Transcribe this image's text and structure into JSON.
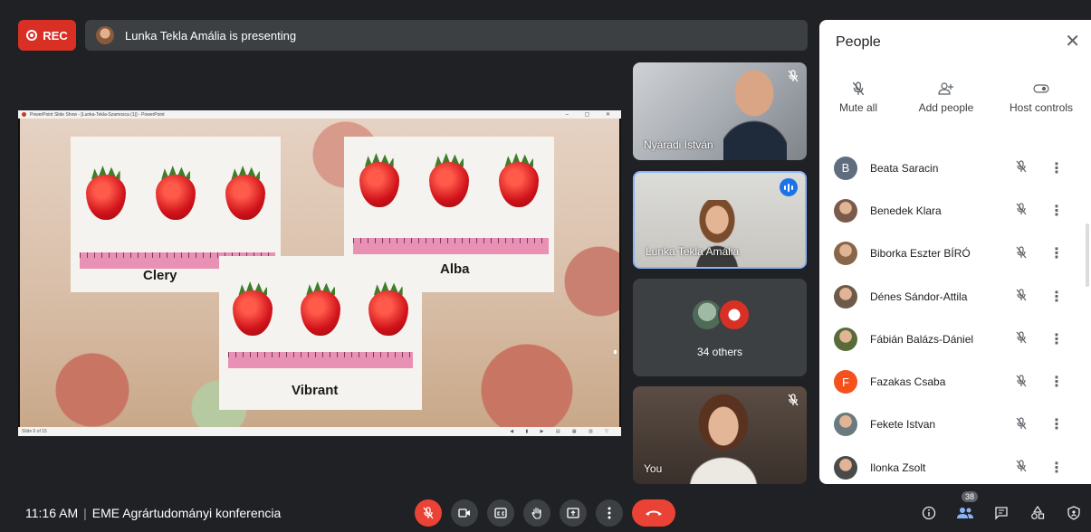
{
  "topbar": {
    "rec_label": "REC",
    "presenting_text": "Lunka Tekla Amália is presenting"
  },
  "presentation": {
    "window_title": "PowerPoint Slide Show - [Lunka-Tekla-Szamosca (1)] - PowerPoint",
    "window_buttons": "– ▢ ✕",
    "slide_labels": [
      "Clery",
      "Alba",
      "Vibrant"
    ],
    "slide_status": "Slide 6 of 15",
    "status_icons": "◀ ▮ ▶ ▤ ▦ ▥ ▽"
  },
  "tiles": [
    {
      "name": "Nyáradi István",
      "muted": true
    },
    {
      "name": "Lunka Tekla Amália",
      "speaking": true
    },
    {
      "others_label": "34 others"
    },
    {
      "name": "You",
      "muted": true
    }
  ],
  "panel": {
    "title": "People",
    "close_icon": "✕",
    "actions": [
      {
        "label": "Mute all",
        "icon": "mic-off-icon"
      },
      {
        "label": "Add people",
        "icon": "add-person-icon"
      },
      {
        "label": "Host controls",
        "icon": "toggle-icon"
      }
    ],
    "participants": [
      {
        "name": "Beata Saracin",
        "initial": "B",
        "color": "#5f6d7e"
      },
      {
        "name": "Benedek Klara",
        "initial": "",
        "color": "#7a5a4a"
      },
      {
        "name": "Biborka Eszter BÍRÓ",
        "initial": "",
        "color": "#8a6548"
      },
      {
        "name": "Dénes Sándor-Attila",
        "initial": "",
        "color": "#6e5a48"
      },
      {
        "name": "Fábián Balázs-Dániel",
        "initial": "",
        "color": "#5a6b3a"
      },
      {
        "name": "Fazakas Csaba",
        "initial": "F",
        "color": "#f4511e"
      },
      {
        "name": "Fekete Istvan",
        "initial": "",
        "color": "#6a7a7e"
      },
      {
        "name": "Ilonka Zsolt",
        "initial": "",
        "color": "#4a4a4a"
      }
    ]
  },
  "bottom": {
    "time": "11:16 AM",
    "separator": "|",
    "meeting_name": "EME Agrártudományi konferencia",
    "people_count": "38"
  },
  "colors": {
    "background": "#202124",
    "accent_blue": "#1a73e8",
    "rec_red": "#d93025",
    "end_call_red": "#ea4335"
  }
}
